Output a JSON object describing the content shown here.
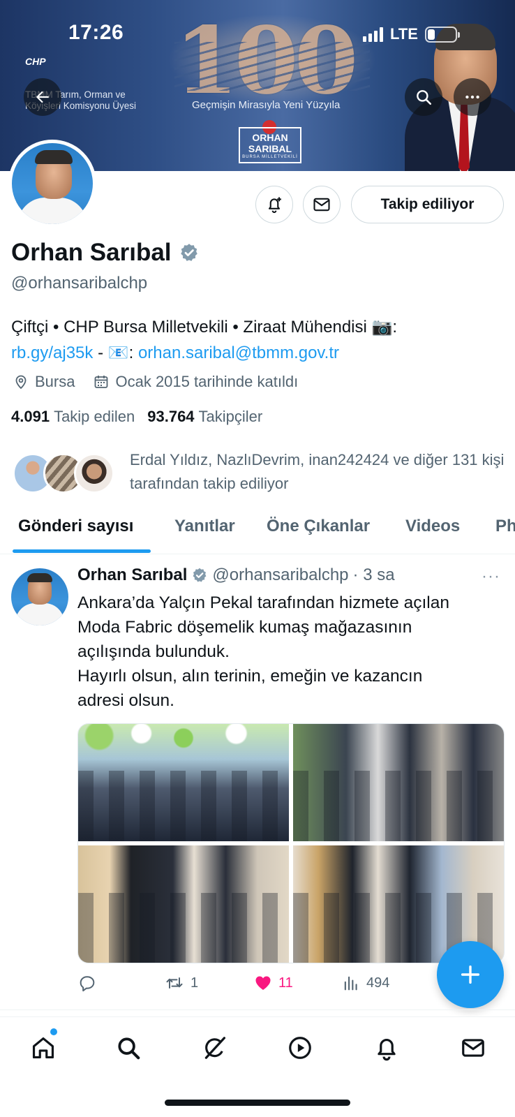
{
  "status_bar": {
    "time": "17:26",
    "network": "LTE"
  },
  "banner": {
    "hundred": "100",
    "motto": "Geçmişin Mirasıyla Yeni Yüzyıla",
    "party": "CHP",
    "party_subtitle": "TBMM Tarım, Orman ve Köyişleri Komisyonu Üyesi",
    "logo_line1": "ORHAN",
    "logo_line2": "SARIBAL",
    "logo_line3": "BURSA MİLLETVEKİLİ"
  },
  "profile": {
    "name": "Orhan Sarıbal",
    "handle": "@orhansaribalchp",
    "follow_button": "Takip ediliyor",
    "bio_text": "Çiftçi • CHP Bursa Milletvekili • Ziraat Mühendisi 📷: ",
    "bio_link": "rb.gy/aj35k",
    "bio_sep": " - 📧: ",
    "bio_email": "orhan.saribal@tbmm.gov.tr",
    "location": "Bursa",
    "joined": "Ocak 2015 tarihinde katıldı",
    "following_count": "4.091",
    "following_label": "Takip edilen",
    "followers_count": "93.764",
    "followers_label": "Takipçiler",
    "followed_by": "Erdal Yıldız, NazlıDevrim, inan242424 ve diğer 131 kişi tarafından takip ediliyor"
  },
  "tabs": [
    {
      "label": "Gönderi sayısı",
      "active": true
    },
    {
      "label": "Yanıtlar",
      "active": false
    },
    {
      "label": "Öne Çıkanlar",
      "active": false
    },
    {
      "label": "Videos",
      "active": false
    },
    {
      "label": "Ph",
      "active": false
    }
  ],
  "tweet": {
    "author": "Orhan Sarıbal",
    "handle": "@orhansaribalchp",
    "time": "· 3 sa",
    "more": "···",
    "text_lines": [
      "Ankara’da Yalçın Pekal tarafından hizmete açılan",
      "Moda Fabric döşemelik kumaş mağazasının",
      "açılışında bulunduk.",
      "Hayırlı olsun, alın terinin, emeğin ve kazancın",
      "adresi olsun."
    ],
    "replies": "",
    "retweets": "1",
    "likes": "11",
    "views": "494"
  },
  "colors": {
    "accent": "#1d9bf0",
    "like": "#f91880",
    "text": "#0f1419",
    "muted": "#536471"
  }
}
